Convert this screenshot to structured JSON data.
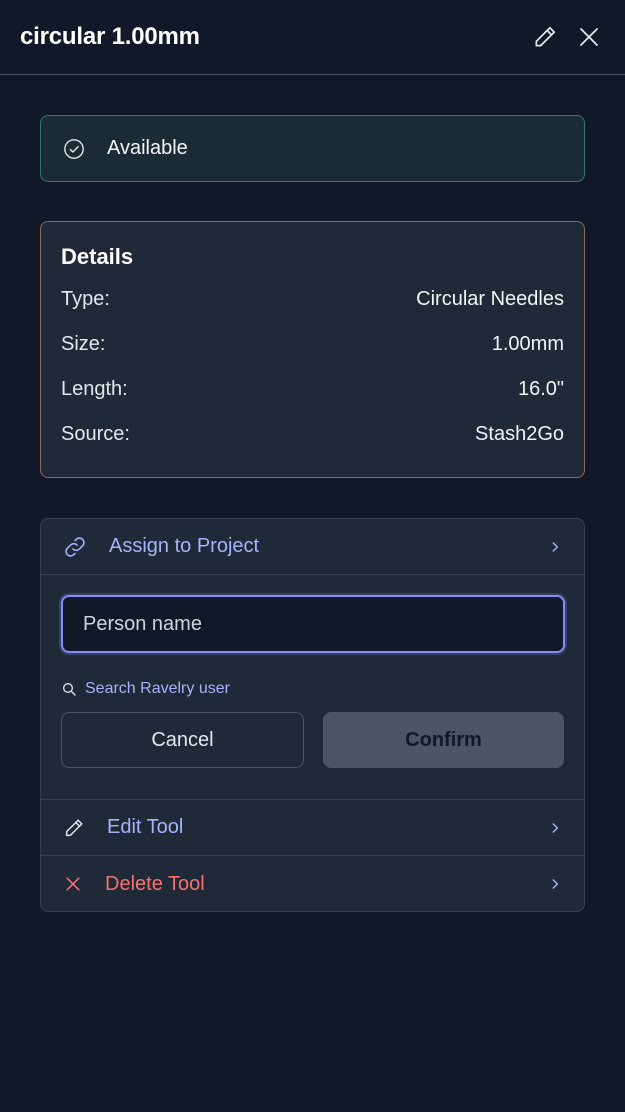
{
  "header": {
    "title": "circular 1.00mm",
    "edit_icon": "pencil-icon",
    "close_icon": "close-icon"
  },
  "status": {
    "label": "Available",
    "icon": "check-circle-icon",
    "color": "#2f7a68"
  },
  "details": {
    "title": "Details",
    "rows": [
      {
        "label": "Type:",
        "value": "Circular Needles"
      },
      {
        "label": "Size:",
        "value": "1.00mm"
      },
      {
        "label": "Length:",
        "value": "16.0\""
      },
      {
        "label": "Source:",
        "value": "Stash2Go"
      }
    ]
  },
  "actions": {
    "assign": {
      "label": "Assign to Project",
      "icon": "link-icon"
    },
    "assign_panel": {
      "input_placeholder": "Person name",
      "input_value": "",
      "search_label": "Search Ravelry user",
      "cancel_label": "Cancel",
      "confirm_label": "Confirm"
    },
    "edit": {
      "label": "Edit Tool",
      "icon": "pencil-icon"
    },
    "delete": {
      "label": "Delete Tool",
      "icon": "x-icon"
    }
  },
  "colors": {
    "accent": "#a5b4fc",
    "danger": "#f87171",
    "background": "#111827",
    "card": "#1f2937"
  }
}
